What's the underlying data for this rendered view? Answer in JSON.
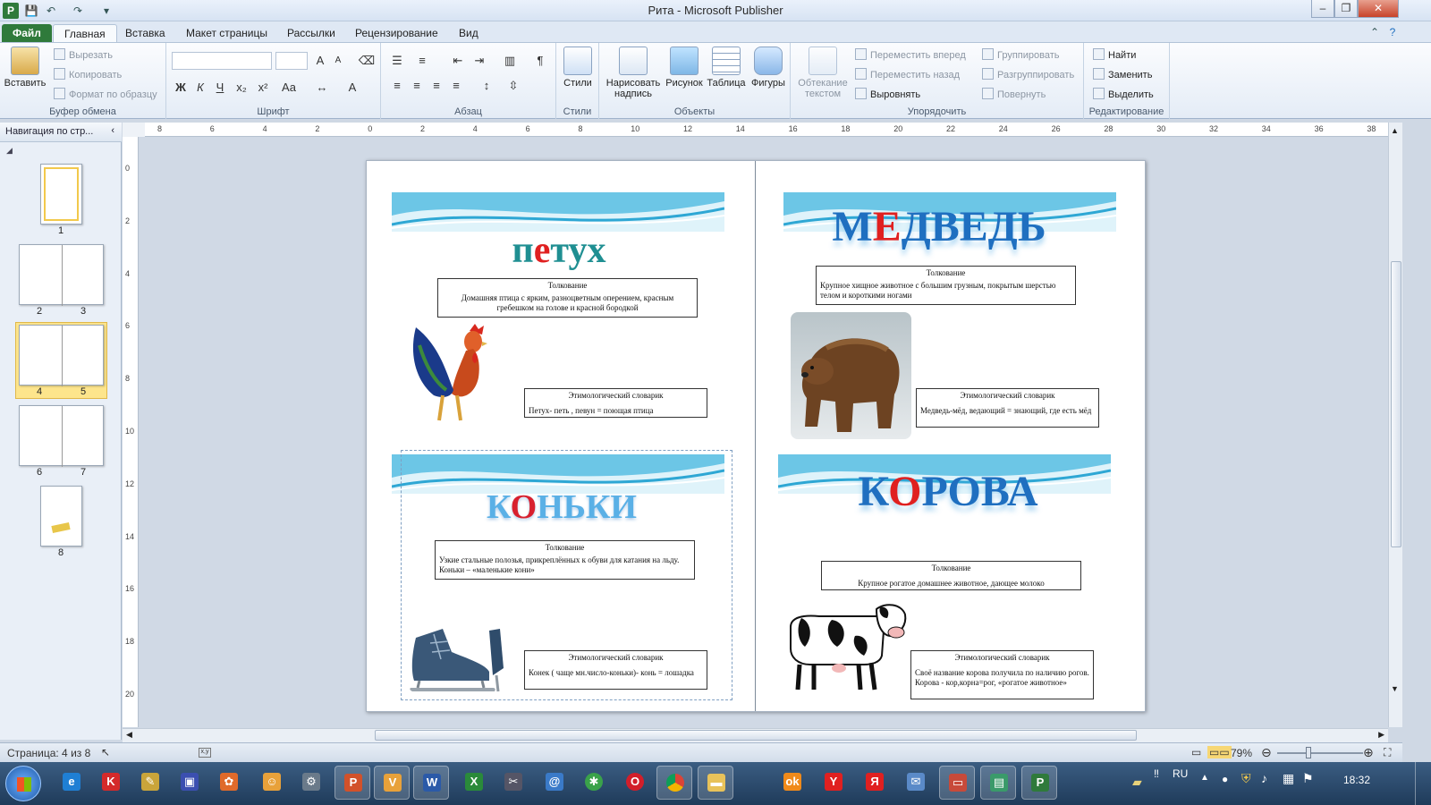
{
  "window": {
    "title": "Рита  -  Microsoft Publisher"
  },
  "tabs": [
    "Файл",
    "Главная",
    "Вставка",
    "Макет страницы",
    "Рассылки",
    "Рецензирование",
    "Вид"
  ],
  "ribbon": {
    "clipboard": {
      "paste": "Вставить",
      "cut": "Вырезать",
      "copy": "Копировать",
      "format_painter": "Формат по образцу",
      "label": "Буфер обмена"
    },
    "font": {
      "label": "Шрифт",
      "bold": "Ж",
      "italic": "К",
      "underline": "Ч",
      "sub": "x₂",
      "sup": "x²",
      "case": "Аа",
      "grow": "A",
      "shrink": "A"
    },
    "paragraph": {
      "label": "Абзац",
      "pilcrow": "¶"
    },
    "styles": {
      "button": "Стили",
      "label": "Стили"
    },
    "objects": {
      "draw_textbox": "Нарисовать надпись",
      "picture": "Рисунок",
      "table": "Таблица",
      "shapes": "Фигуры",
      "label": "Объекты"
    },
    "arrange": {
      "wrap_text": "Обтекание текстом",
      "bring_forward": "Переместить вперед",
      "send_backward": "Переместить назад",
      "align": "Выровнять",
      "group": "Группировать",
      "ungroup": "Разгруппировать",
      "rotate": "Повернуть",
      "label": "Упорядочить"
    },
    "editing": {
      "find": "Найти",
      "replace": "Заменить",
      "select": "Выделить",
      "label": "Редактирование"
    }
  },
  "nav": {
    "title": "Навигация по стр...",
    "pages": [
      "1",
      "2",
      "3",
      "4",
      "5",
      "6",
      "7",
      "8"
    ]
  },
  "ruler_h": [
    "8",
    "6",
    "4",
    "2",
    "0",
    "2",
    "4",
    "6",
    "8",
    "10",
    "12",
    "14",
    "16",
    "18",
    "20",
    "22",
    "24",
    "26",
    "28",
    "30",
    "32",
    "34",
    "36",
    "38"
  ],
  "ruler_v": [
    "0",
    "2",
    "4",
    "6",
    "8",
    "10",
    "12",
    "14",
    "16",
    "18",
    "20"
  ],
  "cards": {
    "petuh": {
      "word_parts": [
        "п",
        "е",
        "тух"
      ],
      "def_title": "Толкование",
      "def_text": "Домашняя птица с ярким, разноцветным оперением, красным гребешком на голове и красной бородкой",
      "etym_title": "Этимологический словарик",
      "etym_text": "Петух- петь , певун = поющая птица"
    },
    "medved": {
      "word_parts": [
        "М",
        "Е",
        "ДВЕДЬ"
      ],
      "def_title": "Толкование",
      "def_text": "Крупное хищное животное с большим грузным, покрытым шерстью телом и короткими ногами",
      "etym_title": "Этимологический словарик",
      "etym_text": "Медведь-мёд, ведающий = знающий, где есть мёд"
    },
    "konki": {
      "word_parts": [
        "К",
        "О",
        "НЬКИ"
      ],
      "def_title": "Толкование",
      "def_text": "Узкие стальные полозья, прикреплённых к обуви для катания на льду. Коньки – «маленькие кони»",
      "etym_title": "Этимологический словарик",
      "etym_text": "Конек ( чаще мн.число-коньки)- конь = лошадка"
    },
    "korova": {
      "word_parts": [
        "К",
        "О",
        "РОВА"
      ],
      "def_title": "Толкование",
      "def_text": "Крупное рогатое домашнее животное, дающее молоко",
      "etym_title": "Этимологический словарик",
      "etym_text": "Своё название корова получила по наличию рогов. Корова - кор,корна=рог, «рогатое животное»"
    }
  },
  "status": {
    "page": "Страница: 4 из 8",
    "zoom": "79%"
  },
  "taskbar": {
    "lang": "RU",
    "time": "18:32"
  },
  "colors": {
    "teal": "#1f8f92",
    "red": "#e02020",
    "blue": "#1f6fc0",
    "lightblue": "#5ab0e6",
    "ribbon_bg": "#e4ecf6"
  }
}
